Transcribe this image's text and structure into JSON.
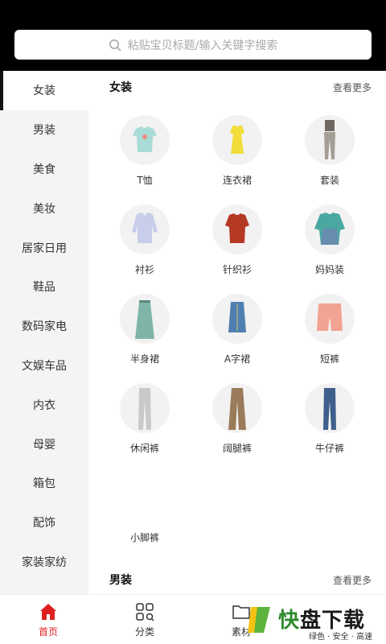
{
  "search": {
    "placeholder": "粘贴宝贝标题/输入关键字搜索"
  },
  "sidebar": {
    "items": [
      {
        "label": "女装",
        "active": true
      },
      {
        "label": "男装"
      },
      {
        "label": "美食"
      },
      {
        "label": "美妆"
      },
      {
        "label": "居家日用"
      },
      {
        "label": "鞋品"
      },
      {
        "label": "数码家电"
      },
      {
        "label": "文娱车品"
      },
      {
        "label": "内衣"
      },
      {
        "label": "母婴"
      },
      {
        "label": "箱包"
      },
      {
        "label": "配饰"
      },
      {
        "label": "家装家纺"
      }
    ]
  },
  "section1": {
    "title": "女装",
    "more": "查看更多",
    "items": [
      {
        "label": "T恤",
        "icon": "tshirt-icon"
      },
      {
        "label": "连衣裙",
        "icon": "dress-icon"
      },
      {
        "label": "套装",
        "icon": "suit-icon"
      },
      {
        "label": "衬衫",
        "icon": "shirt-icon"
      },
      {
        "label": "针织衫",
        "icon": "sweater-icon"
      },
      {
        "label": "妈妈装",
        "icon": "mom-wear-icon"
      },
      {
        "label": "半身裙",
        "icon": "skirt-icon"
      },
      {
        "label": "A字裙",
        "icon": "a-line-skirt-icon"
      },
      {
        "label": "短裤",
        "icon": "shorts-icon"
      },
      {
        "label": "休闲裤",
        "icon": "casual-pants-icon"
      },
      {
        "label": "阔腿裤",
        "icon": "wide-leg-pants-icon"
      },
      {
        "label": "牛仔裤",
        "icon": "jeans-icon"
      },
      {
        "label": "小脚裤",
        "icon": "skinny-pants-icon"
      }
    ]
  },
  "section2": {
    "title": "男装",
    "more": "查看更多"
  },
  "tabbar": {
    "items": [
      {
        "label": "首页",
        "icon": "home-icon",
        "active": true
      },
      {
        "label": "分类",
        "icon": "category-icon"
      },
      {
        "label": "素材",
        "icon": "folder-icon"
      }
    ]
  },
  "watermark": {
    "main1": "快",
    "main2": "盘下载",
    "sub": "绿色 · 安全 · 高速"
  },
  "colors": {
    "active_tab": "#e02020",
    "header": "#000000",
    "sidebar_bg": "#f4f4f4"
  }
}
